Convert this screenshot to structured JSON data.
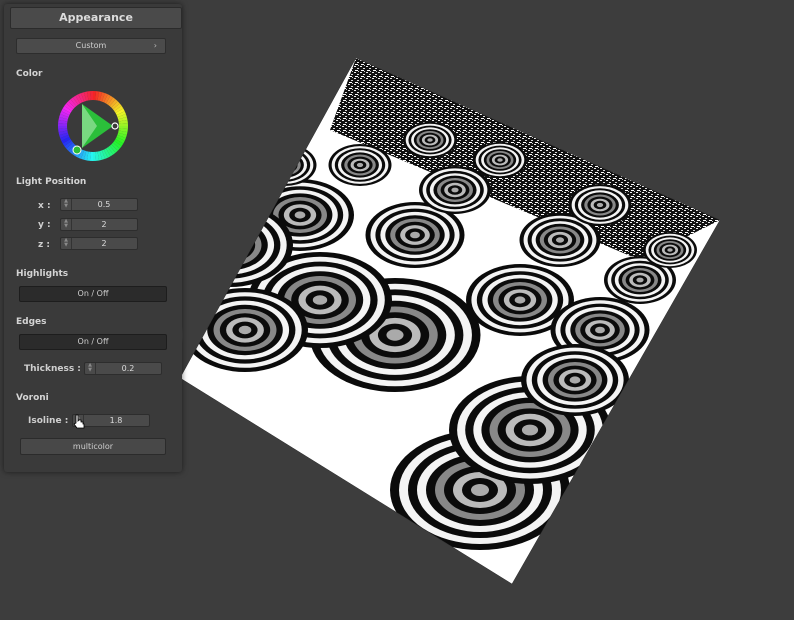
{
  "panel": {
    "title": "Appearance",
    "preset": {
      "label": "Custom",
      "chevron": "›"
    },
    "color": {
      "section": "Color"
    },
    "light_position": {
      "section": "Light Position",
      "x": {
        "label": "x :",
        "value": "0.5"
      },
      "y": {
        "label": "y :",
        "value": "2"
      },
      "z": {
        "label": "z :",
        "value": "2"
      }
    },
    "highlights": {
      "section": "Highlights",
      "toggle": "On / Off"
    },
    "edges": {
      "section": "Edges",
      "toggle": "On / Off",
      "thickness_label": "Thickness :",
      "thickness_value": "0.2"
    },
    "voronoi": {
      "section": "Voroni",
      "isoline_label": "Isoline :",
      "isoline_value": "1.8",
      "multicolor": "multicolor"
    }
  },
  "colors": {
    "background": "#3d3d3d",
    "panel": "#3a3a3a",
    "accent": "#2bbf3a"
  },
  "icons": [
    "color-wheel-icon",
    "spinner-icon",
    "chevron-right-icon",
    "hand-cursor-icon"
  ]
}
